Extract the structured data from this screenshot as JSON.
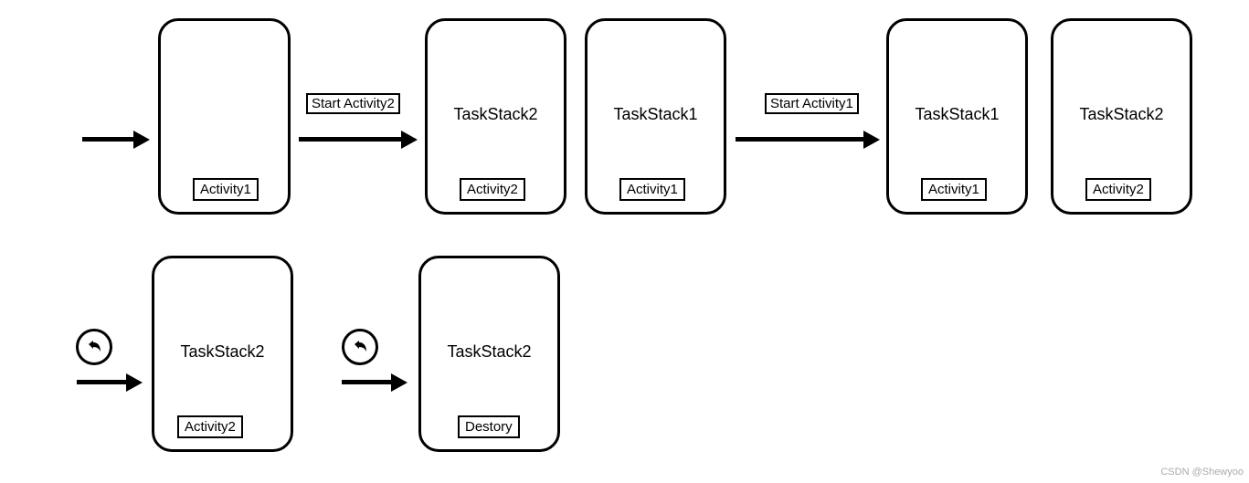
{
  "row1": {
    "arrow1_label": "",
    "stack1": {
      "title": "",
      "activity": "Activity1"
    },
    "arrow2_label": "Start Activity2",
    "stack2": {
      "title": "TaskStack2",
      "activity": "Activity2"
    },
    "stack3": {
      "title": "TaskStack1",
      "activity": "Activity1"
    },
    "arrow3_label": "Start Activity1",
    "stack4": {
      "title": "TaskStack1",
      "activity": "Activity1"
    },
    "stack5": {
      "title": "TaskStack2",
      "activity": "Activity2"
    }
  },
  "row2": {
    "back1": "back",
    "stack6": {
      "title": "TaskStack2",
      "activity": "Activity2"
    },
    "back2": "back",
    "stack7": {
      "title": "TaskStack2",
      "activity": "Destory"
    }
  },
  "watermark": "CSDN @Shewyoo"
}
